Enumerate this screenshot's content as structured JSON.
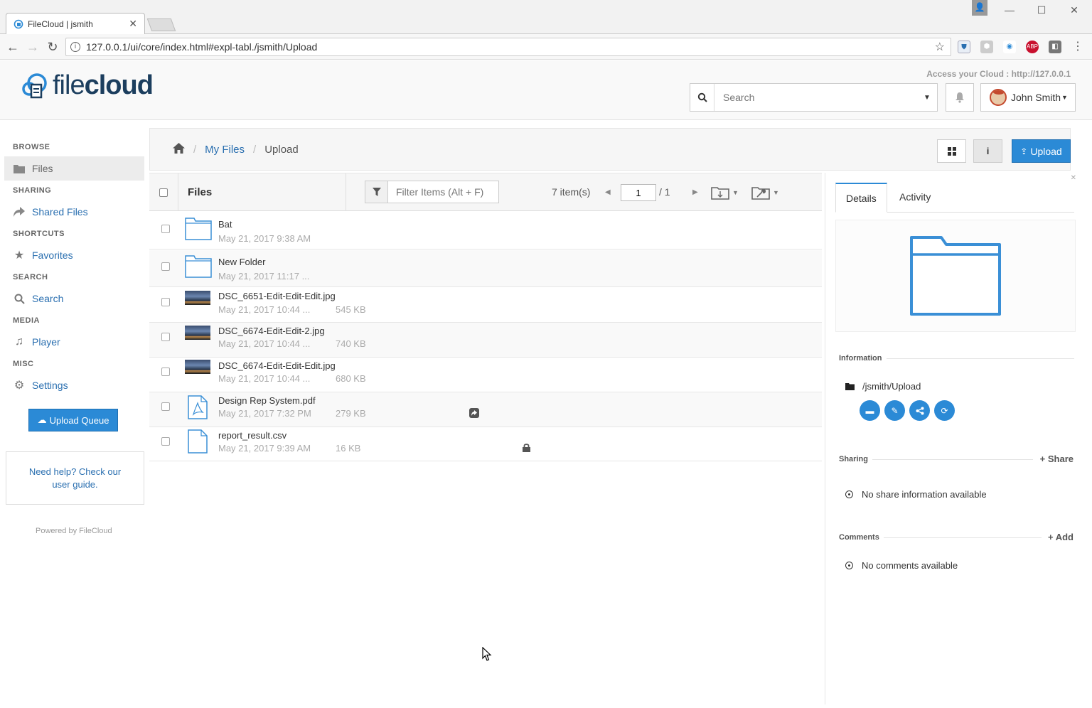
{
  "browser": {
    "tab_title": "FileCloud | jsmith",
    "url": "127.0.0.1/ui/core/index.html#expl-tabl./jsmith/Upload"
  },
  "header": {
    "logo_bold": "file",
    "logo_light": "cloud",
    "access_text": "Access your Cloud : http://127.0.0.1",
    "search_placeholder": "Search",
    "user_name": "John Smith"
  },
  "sidebar": {
    "sections": {
      "browse": "BROWSE",
      "sharing": "SHARING",
      "shortcuts": "SHORTCUTS",
      "search": "SEARCH",
      "media": "MEDIA",
      "misc": "MISC"
    },
    "items": {
      "files": "Files",
      "shared": "Shared Files",
      "favorites": "Favorites",
      "search": "Search",
      "player": "Player",
      "settings": "Settings"
    },
    "upload_queue": "Upload Queue",
    "help_line1": "Need help? Check our",
    "help_line2": "user guide.",
    "powered": "Powered by FileCloud"
  },
  "breadcrumb": {
    "home_icon": "home-icon",
    "my_files": "My Files",
    "current": "Upload"
  },
  "toolbar": {
    "upload_label": "Upload",
    "info_label": "i"
  },
  "list": {
    "header": "Files",
    "filter_placeholder": "Filter Items (Alt + F)",
    "items_count": "7 item(s)",
    "page": "1",
    "page_total": "/ 1",
    "rows": [
      {
        "name": "Bat",
        "date": "May 21, 2017 9:38 AM",
        "size": "",
        "type": "folder"
      },
      {
        "name": "New Folder",
        "date": "May 21, 2017 11:17 ...",
        "size": "",
        "type": "folder"
      },
      {
        "name": "DSC_6651-Edit-Edit-Edit.jpg",
        "date": "May 21, 2017 10:44 ...",
        "size": "545 KB",
        "type": "image"
      },
      {
        "name": "DSC_6674-Edit-Edit-2.jpg",
        "date": "May 21, 2017 10:44 ...",
        "size": "740 KB",
        "type": "image"
      },
      {
        "name": "DSC_6674-Edit-Edit-Edit.jpg",
        "date": "May 21, 2017 10:44 ...",
        "size": "680 KB",
        "type": "image"
      },
      {
        "name": "Design Rep System.pdf",
        "date": "May 21, 2017 7:32 PM",
        "size": "279 KB",
        "type": "pdf"
      },
      {
        "name": "report_result.csv",
        "date": "May 21, 2017 9:39 AM",
        "size": "16 KB",
        "type": "file"
      }
    ]
  },
  "details": {
    "tab_details": "Details",
    "tab_activity": "Activity",
    "information": "Information",
    "path": "/jsmith/Upload",
    "sharing": "Sharing",
    "share_link": "Share",
    "no_share": "No share information available",
    "comments": "Comments",
    "add_link": "Add",
    "no_comments": "No comments available"
  },
  "colors": {
    "accent": "#2b8ad6",
    "link": "#2a6fb0",
    "brand": "#1c3e5e"
  }
}
